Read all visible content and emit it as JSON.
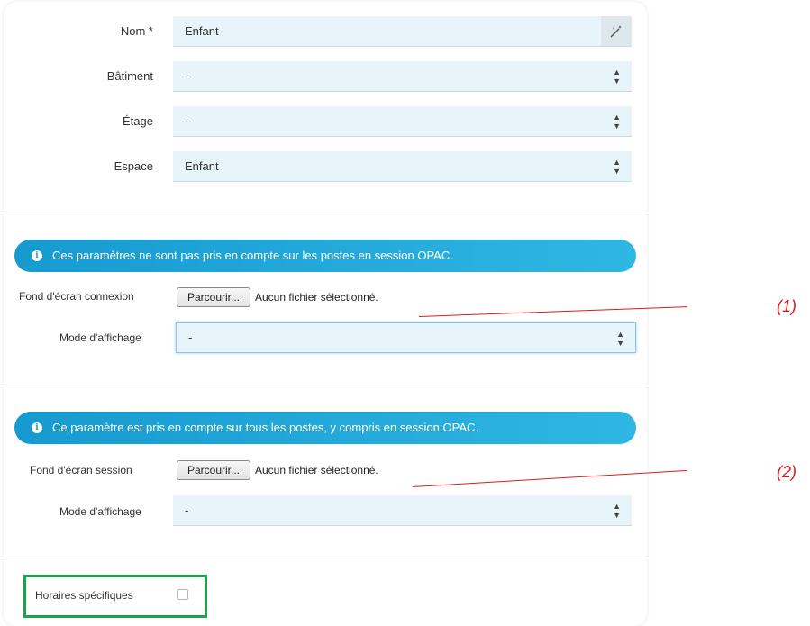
{
  "form": {
    "nom": {
      "label": "Nom *",
      "value": "Enfant"
    },
    "batiment": {
      "label": "Bâtiment",
      "value": "-"
    },
    "etage": {
      "label": "Étage",
      "value": "-"
    },
    "espace": {
      "label": "Espace",
      "value": "Enfant"
    }
  },
  "section_connexion": {
    "banner": "Ces paramètres ne sont pas pris en compte sur les postes en session OPAC.",
    "fond_label": "Fond d'écran connexion",
    "browse_label": "Parcourir...",
    "file_status": "Aucun fichier sélectionné.",
    "mode_label": "Mode d'affichage",
    "mode_value": "-"
  },
  "section_session": {
    "banner": "Ce paramètre est pris en compte sur tous les postes, y compris en session OPAC.",
    "fond_label": "Fond d'écran session",
    "browse_label": "Parcourir...",
    "file_status": "Aucun fichier sélectionné.",
    "mode_label": "Mode d'affichage",
    "mode_value": "-"
  },
  "horaires": {
    "label": "Horaires spécifiques",
    "checked": false
  },
  "annotations": {
    "one": "(1)",
    "two": "(2)"
  },
  "colors": {
    "banner": "#2fb7e3",
    "field_bg": "#e7f4fa",
    "annotation": "#e0191b",
    "highlight": "#20a14a"
  }
}
